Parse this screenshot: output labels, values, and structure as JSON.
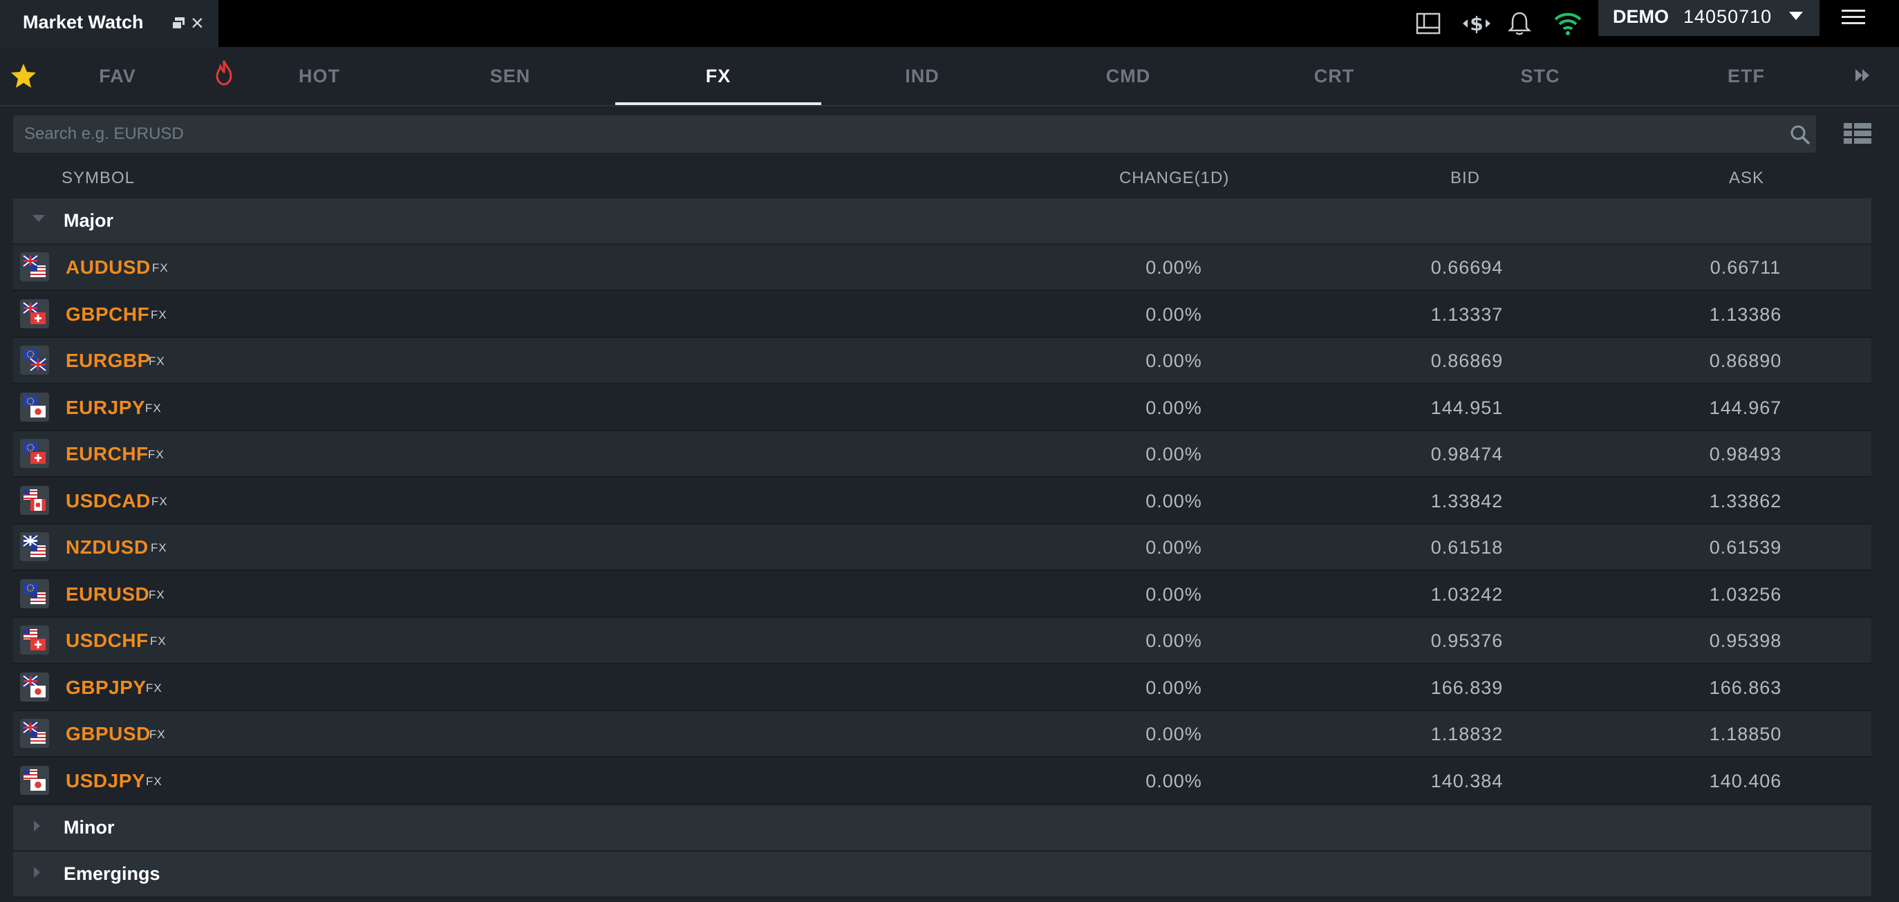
{
  "window": {
    "title": "Market Watch"
  },
  "account": {
    "mode": "DEMO",
    "number": "14050710"
  },
  "tabs": [
    {
      "id": "fav",
      "label": "FAV"
    },
    {
      "id": "hot",
      "label": "HOT"
    },
    {
      "id": "sen",
      "label": "SEN"
    },
    {
      "id": "fx",
      "label": "FX",
      "active": true
    },
    {
      "id": "ind",
      "label": "IND"
    },
    {
      "id": "cmd",
      "label": "CMD"
    },
    {
      "id": "crt",
      "label": "CRT"
    },
    {
      "id": "stc",
      "label": "STC"
    },
    {
      "id": "etf",
      "label": "ETF"
    }
  ],
  "search": {
    "placeholder": "Search e.g. EURUSD"
  },
  "columns": {
    "symbol": "SYMBOL",
    "change": "CHANGE(1D)",
    "bid": "BID",
    "ask": "ASK"
  },
  "groups": [
    {
      "label": "Major",
      "expanded": true
    },
    {
      "label": "Minor",
      "expanded": false
    },
    {
      "label": "Emergings",
      "expanded": false
    }
  ],
  "rows": [
    {
      "symbol": "AUDUSD",
      "tag": "FX",
      "change": "0.00%",
      "bid": "0.66694",
      "ask": "0.66711",
      "base": "au",
      "quote": "us"
    },
    {
      "symbol": "GBPCHF",
      "tag": "FX",
      "change": "0.00%",
      "bid": "1.13337",
      "ask": "1.13386",
      "base": "gb",
      "quote": "ch"
    },
    {
      "symbol": "EURGBP",
      "tag": "FX",
      "change": "0.00%",
      "bid": "0.86869",
      "ask": "0.86890",
      "base": "eu",
      "quote": "gb"
    },
    {
      "symbol": "EURJPY",
      "tag": "FX",
      "change": "0.00%",
      "bid": "144.951",
      "ask": "144.967",
      "base": "eu",
      "quote": "jp"
    },
    {
      "symbol": "EURCHF",
      "tag": "FX",
      "change": "0.00%",
      "bid": "0.98474",
      "ask": "0.98493",
      "base": "eu",
      "quote": "ch"
    },
    {
      "symbol": "USDCAD",
      "tag": "FX",
      "change": "0.00%",
      "bid": "1.33842",
      "ask": "1.33862",
      "base": "us",
      "quote": "ca"
    },
    {
      "symbol": "NZDUSD",
      "tag": "FX",
      "change": "0.00%",
      "bid": "0.61518",
      "ask": "0.61539",
      "base": "nz",
      "quote": "us"
    },
    {
      "symbol": "EURUSD",
      "tag": "FX",
      "change": "0.00%",
      "bid": "1.03242",
      "ask": "1.03256",
      "base": "eu",
      "quote": "us"
    },
    {
      "symbol": "USDCHF",
      "tag": "FX",
      "change": "0.00%",
      "bid": "0.95376",
      "ask": "0.95398",
      "base": "us",
      "quote": "ch"
    },
    {
      "symbol": "GBPJPY",
      "tag": "FX",
      "change": "0.00%",
      "bid": "166.839",
      "ask": "166.863",
      "base": "gb",
      "quote": "jp"
    },
    {
      "symbol": "GBPUSD",
      "tag": "FX",
      "change": "0.00%",
      "bid": "1.18832",
      "ask": "1.18850",
      "base": "gb",
      "quote": "us"
    },
    {
      "symbol": "USDJPY",
      "tag": "FX",
      "change": "0.00%",
      "bid": "140.384",
      "ask": "140.406",
      "base": "us",
      "quote": "jp"
    }
  ],
  "colors": {
    "background": "#1d2328",
    "symbol": "#f08a1e",
    "wifi": "#1fc36a",
    "hot": "#e53935",
    "star": "#f5c518"
  }
}
